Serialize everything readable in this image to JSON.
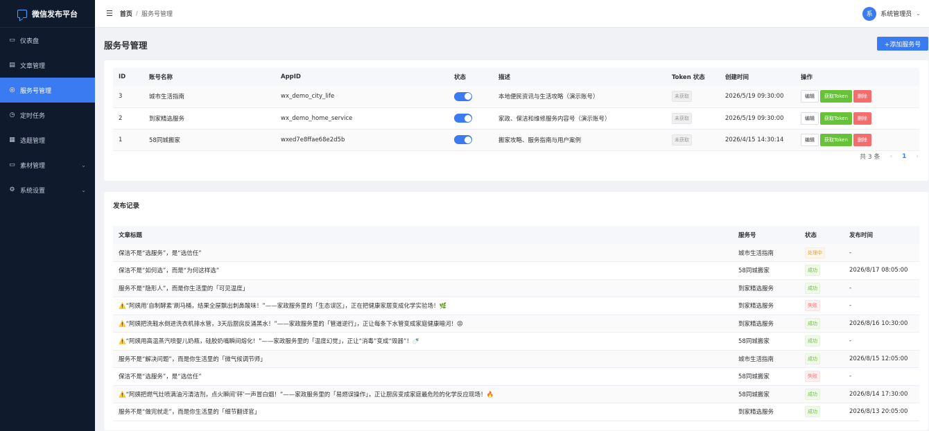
{
  "app": {
    "title": "微信发布平台"
  },
  "sidebar": {
    "items": [
      {
        "label": "仪表盘",
        "icon": "monitor-icon",
        "glyph": "▭",
        "active": false,
        "expandable": false
      },
      {
        "label": "文章管理",
        "icon": "document-icon",
        "glyph": "▤",
        "active": false,
        "expandable": false
      },
      {
        "label": "服务号管理",
        "icon": "wechat-icon",
        "glyph": "◎",
        "active": true,
        "expandable": false
      },
      {
        "label": "定时任务",
        "icon": "clock-icon",
        "glyph": "◷",
        "active": false,
        "expandable": false
      },
      {
        "label": "选题管理",
        "icon": "bookmark-icon",
        "glyph": "▦",
        "active": false,
        "expandable": false
      },
      {
        "label": "素材管理",
        "icon": "folder-icon",
        "glyph": "▭",
        "active": false,
        "expandable": true
      },
      {
        "label": "系统设置",
        "icon": "gear-icon",
        "glyph": "⚙",
        "active": false,
        "expandable": true
      }
    ]
  },
  "header": {
    "breadcrumb": {
      "home": "首页",
      "separator": "/",
      "current": "服务号管理"
    },
    "user": {
      "avatar_text": "系",
      "name": "系统管理员"
    }
  },
  "page": {
    "title": "服务号管理",
    "add_button": "+添加服务号"
  },
  "accounts": {
    "columns": [
      "ID",
      "账号名称",
      "AppID",
      "状态",
      "描述",
      "Token 状态",
      "创建时间",
      "操作"
    ],
    "rows": [
      {
        "id": "3",
        "name": "城市生活指南",
        "appid": "wx_demo_city_life",
        "enabled": true,
        "desc": "本地便民资讯与生活攻略（演示账号）",
        "token_status": "未获取",
        "created": "2026/5/19 09:30:00"
      },
      {
        "id": "2",
        "name": "到家精选服务",
        "appid": "wx_demo_home_service",
        "enabled": true,
        "desc": "家政、保洁和维修服务内容号（演示账号）",
        "token_status": "未获取",
        "created": "2026/5/19 09:30:00"
      },
      {
        "id": "1",
        "name": "58同城搬家",
        "appid": "wxed7e8ffae68e2d5b",
        "enabled": true,
        "desc": "搬家攻略、服务指南与用户案例",
        "token_status": "未获取",
        "created": "2026/4/15 14:30:14"
      }
    ],
    "actions": {
      "edit": "编辑",
      "token": "获取Token",
      "delete": "删除"
    },
    "pagination": {
      "total": "共 3 条",
      "current": "1",
      "prev": "‹",
      "next": "›"
    }
  },
  "records": {
    "title": "发布记录",
    "columns": [
      "文章标题",
      "服务号",
      "状态",
      "发布时间"
    ],
    "rows": [
      {
        "title": "保洁不是“选服务”，是“选信任”",
        "account": "城市生活指南",
        "status": "处理中",
        "status_type": "proc",
        "time": "-"
      },
      {
        "title": "保洁不是“如何选”，而是“为何这样选”",
        "account": "58同城搬家",
        "status": "成功",
        "status_type": "success",
        "time": "2026/8/17 08:05:00"
      },
      {
        "title": "服务不是“隐形人”，而是你生活里的「可见温度」",
        "account": "到家精选服务",
        "status": "成功",
        "status_type": "success",
        "time": "-"
      },
      {
        "title": "⚠️“阿姨用‘自制酵素’刷马桶，结果全屋飘出刺鼻酸味！”——家政服务里的「生态误区」，正在把健康家居变成化学实验场！🌿",
        "account": "到家精选服务",
        "status": "失败",
        "status_type": "fail",
        "time": "-"
      },
      {
        "title": "⚠️“阿姨把洗鞋水倒进洗衣机排水管，3天后厨房反涌黑水！”——家政服务里的「管道逆行」，正让每条下水管变成家庭健康暗河！😡",
        "account": "到家精选服务",
        "status": "成功",
        "status_type": "success",
        "time": "2026/8/16 10:30:00"
      },
      {
        "title": "⚠️“阿姨用高温蒸汽喷婴儿奶瓶，硅胶奶嘴瞬间熔化！”——家政服务里的「温度幻觉」，正让“消毒”变成“毁器”！🍼",
        "account": "58同城搬家",
        "status": "成功",
        "status_type": "success",
        "time": "-"
      },
      {
        "title": "服务不是“解决问题”，而是你生活里的「微气候调节师」",
        "account": "城市生活指南",
        "status": "成功",
        "status_type": "success",
        "time": "2026/8/15 12:05:00"
      },
      {
        "title": "保洁不是“选服务”，是“选信任”",
        "account": "58同城搬家",
        "status": "失败",
        "status_type": "fail",
        "time": "-"
      },
      {
        "title": "⚠️“阿姨把燃气灶喷满油污清洁剂，点火瞬间‘砰’一声冒白烟！”——家政服务里的「易燃误操作」，正让厨房变成家庭最危险的化学反应现场！🔥",
        "account": "58同城搬家",
        "status": "成功",
        "status_type": "success",
        "time": "2026/8/14 17:30:00"
      },
      {
        "title": "服务不是“做完就走”，而是你生活里的「细节翻译官」",
        "account": "到家精选服务",
        "status": "成功",
        "status_type": "success",
        "time": "2026/8/13 20:05:00"
      }
    ]
  },
  "colors": {
    "primary": "#3a7bf2",
    "sidebar_bg": "#0f1b2d",
    "success": "#67c23a",
    "danger": "#f56c6c",
    "warning": "#e6a23c"
  }
}
